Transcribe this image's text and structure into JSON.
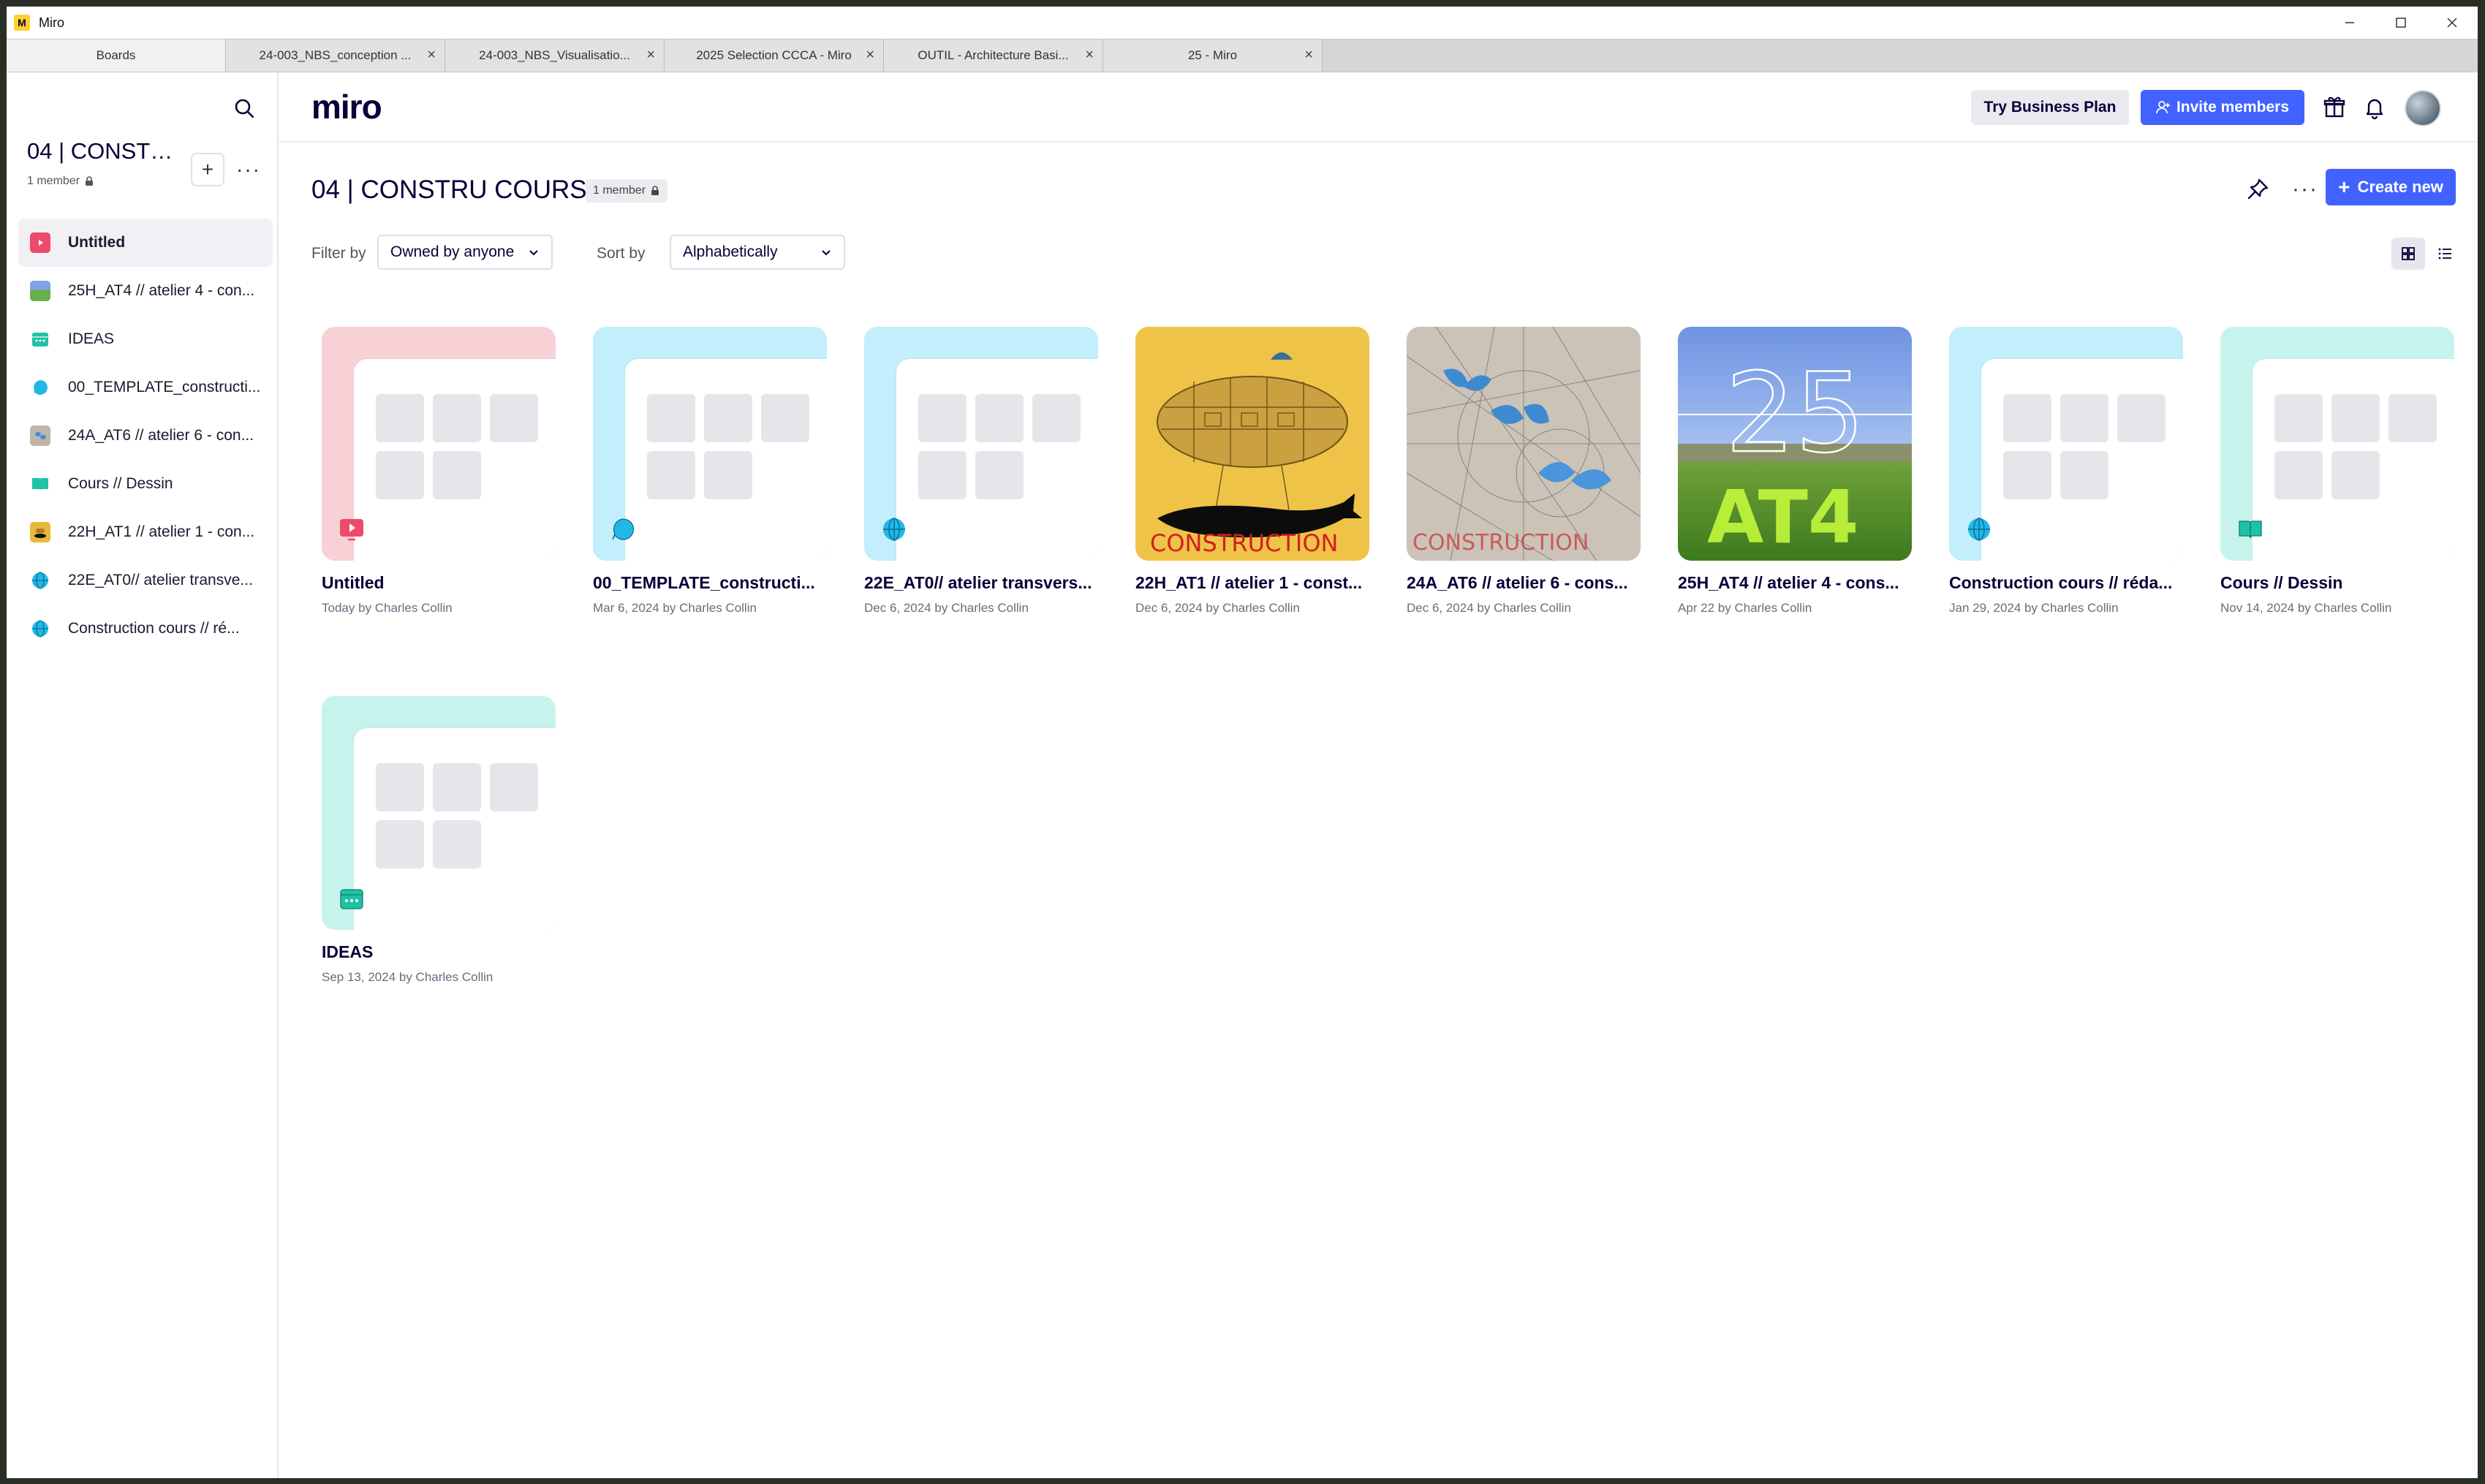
{
  "window": {
    "title": "Miro",
    "app_icon": "miro-logo-icon"
  },
  "tabs": [
    {
      "label": "Boards",
      "active": true
    },
    {
      "label": "24-003_NBS_conception ..."
    },
    {
      "label": "24-003_NBS_Visualisatio..."
    },
    {
      "label": "2025 Selection CCCA - Miro"
    },
    {
      "label": "OUTIL - Architecture Basi..."
    },
    {
      "label": "25 - Miro"
    }
  ],
  "sidebar": {
    "team_title": "04 | CONSTR...",
    "members": "1 member",
    "items": [
      {
        "label": "Untitled",
        "icon": "presentation-icon",
        "active": true
      },
      {
        "label": "25H_AT4 // atelier 4 - con...",
        "icon": "board-thumbnail-icon"
      },
      {
        "label": "IDEAS",
        "icon": "calendar-icon"
      },
      {
        "label": "00_TEMPLATE_constructi...",
        "icon": "chat-bubble-icon"
      },
      {
        "label": "24A_AT6 // atelier 6 - con...",
        "icon": "board-thumbnail-icon"
      },
      {
        "label": "Cours // Dessin",
        "icon": "book-icon"
      },
      {
        "label": "22H_AT1 // atelier 1 - con...",
        "icon": "board-thumbnail-icon"
      },
      {
        "label": "22E_AT0// atelier transve...",
        "icon": "globe-icon"
      },
      {
        "label": "Construction cours // ré...",
        "icon": "globe-icon"
      }
    ]
  },
  "header": {
    "logo": "miro",
    "try_business": "Try Business Plan",
    "invite": "Invite members"
  },
  "main": {
    "title": "04 | CONSTRU COURS",
    "member_badge": "1 member",
    "create_new": "Create new",
    "filter_label": "Filter by",
    "filter_value": "Owned by anyone",
    "sort_label": "Sort by",
    "sort_value": "Alphabetically"
  },
  "colors": {
    "accent": "#4262ff",
    "pink": "#f7d1d6",
    "cyan": "#c3eefb",
    "teal": "#c6f4ec"
  },
  "boards": [
    {
      "title": "Untitled",
      "subtitle": "Today by Charles Collin",
      "style": "placeholder",
      "bg": "#f7d1d6",
      "icon": "presentation-icon",
      "icon_color": "#ee4a6a"
    },
    {
      "title": "00_TEMPLATE_constructi...",
      "subtitle": "Mar 6, 2024 by Charles Collin",
      "style": "placeholder",
      "bg": "#c3eefb",
      "icon": "chat-bubble-icon",
      "icon_color": "#21b8e8"
    },
    {
      "title": "22E_AT0// atelier transvers...",
      "subtitle": "Dec 6, 2024 by Charles Collin",
      "style": "placeholder",
      "bg": "#c3eefb",
      "icon": "globe-icon",
      "icon_color": "#21b8e8"
    },
    {
      "title": "22H_AT1 // atelier 1 - const...",
      "subtitle": "Dec 6, 2024 by Charles Collin",
      "style": "image-yellow",
      "thumb_text": "CONSTRUCTION"
    },
    {
      "title": "24A_AT6 // atelier 6 - cons...",
      "subtitle": "Dec 6, 2024 by Charles Collin",
      "style": "image-sketch",
      "thumb_text": "CONSTRUCTION"
    },
    {
      "title": "25H_AT4 // atelier 4 - cons...",
      "subtitle": "Apr 22 by Charles Collin",
      "style": "image-field",
      "thumb_text": "25",
      "thumb_text2": "AT4"
    },
    {
      "title": "Construction cours // réda...",
      "subtitle": "Jan 29, 2024 by Charles Collin",
      "style": "placeholder",
      "bg": "#c3eefb",
      "icon": "globe-icon",
      "icon_color": "#21b8e8"
    },
    {
      "title": "Cours // Dessin",
      "subtitle": "Nov 14, 2024 by Charles Collin",
      "style": "placeholder",
      "bg": "#c6f4ec",
      "icon": "book-icon",
      "icon_color": "#1ec2a4"
    },
    {
      "title": "IDEAS",
      "subtitle": "Sep 13, 2024 by Charles Collin",
      "style": "placeholder",
      "bg": "#c6f4ec",
      "icon": "calendar-icon",
      "icon_color": "#1ec2a4"
    }
  ]
}
